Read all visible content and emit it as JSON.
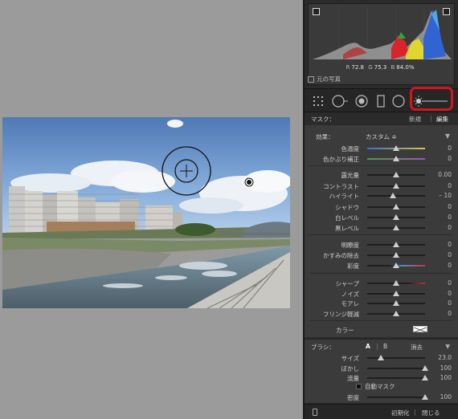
{
  "histogram": {
    "r_label": "R",
    "r_value": "72.8",
    "g_label": "G",
    "g_value": "75.3",
    "b_label": "B",
    "b_value": "84.0%"
  },
  "original_photo_label": "元の写真",
  "mask": {
    "label": "マスク：",
    "new": "新規",
    "edit": "編集"
  },
  "effect": {
    "label": "効果：",
    "value": "カスタム ≑"
  },
  "sliders": {
    "temp": {
      "label": "色温度",
      "value": "0",
      "pos": 0.5
    },
    "tint": {
      "label": "色かぶり補正",
      "value": "0",
      "pos": 0.5
    },
    "exposure": {
      "label": "露光量",
      "value": "0.00",
      "pos": 0.5
    },
    "contrast": {
      "label": "コントラスト",
      "value": "0",
      "pos": 0.5
    },
    "highlights": {
      "label": "ハイライト",
      "value": "– 10",
      "pos": 0.45
    },
    "shadows": {
      "label": "シャドウ",
      "value": "0",
      "pos": 0.5
    },
    "whites": {
      "label": "白レベル",
      "value": "0",
      "pos": 0.5
    },
    "blacks": {
      "label": "黒レベル",
      "value": "0",
      "pos": 0.5
    },
    "clarity": {
      "label": "明瞭度",
      "value": "0",
      "pos": 0.5
    },
    "dehaze": {
      "label": "かすみの除去",
      "value": "0",
      "pos": 0.5
    },
    "saturation": {
      "label": "彩度",
      "value": "0",
      "pos": 0.5
    },
    "sharpness": {
      "label": "シャープ",
      "value": "0",
      "pos": 0.5
    },
    "noise": {
      "label": "ノイズ",
      "value": "0",
      "pos": 0.5
    },
    "moire": {
      "label": "モアレ",
      "value": "0",
      "pos": 0.5
    },
    "defringe": {
      "label": "フリンジ軽減",
      "value": "0",
      "pos": 0.5
    }
  },
  "color_label": "カラー",
  "brush": {
    "label": "ブラシ：",
    "a": "A",
    "b": "B",
    "erase": "消去",
    "size": {
      "label": "サイズ",
      "value": "23.0",
      "pos": 0.23
    },
    "feather": {
      "label": "ぼかし",
      "value": "100",
      "pos": 1.0
    },
    "flow": {
      "label": "流量",
      "value": "100",
      "pos": 1.0
    },
    "automask": "自動マスク",
    "density": {
      "label": "密度",
      "value": "100",
      "pos": 1.0
    }
  },
  "footer": {
    "reset": "初期化",
    "close": "閉じる"
  },
  "colors": {
    "panel_bg": "#3b3b3b",
    "highlight": "#d7141c"
  }
}
